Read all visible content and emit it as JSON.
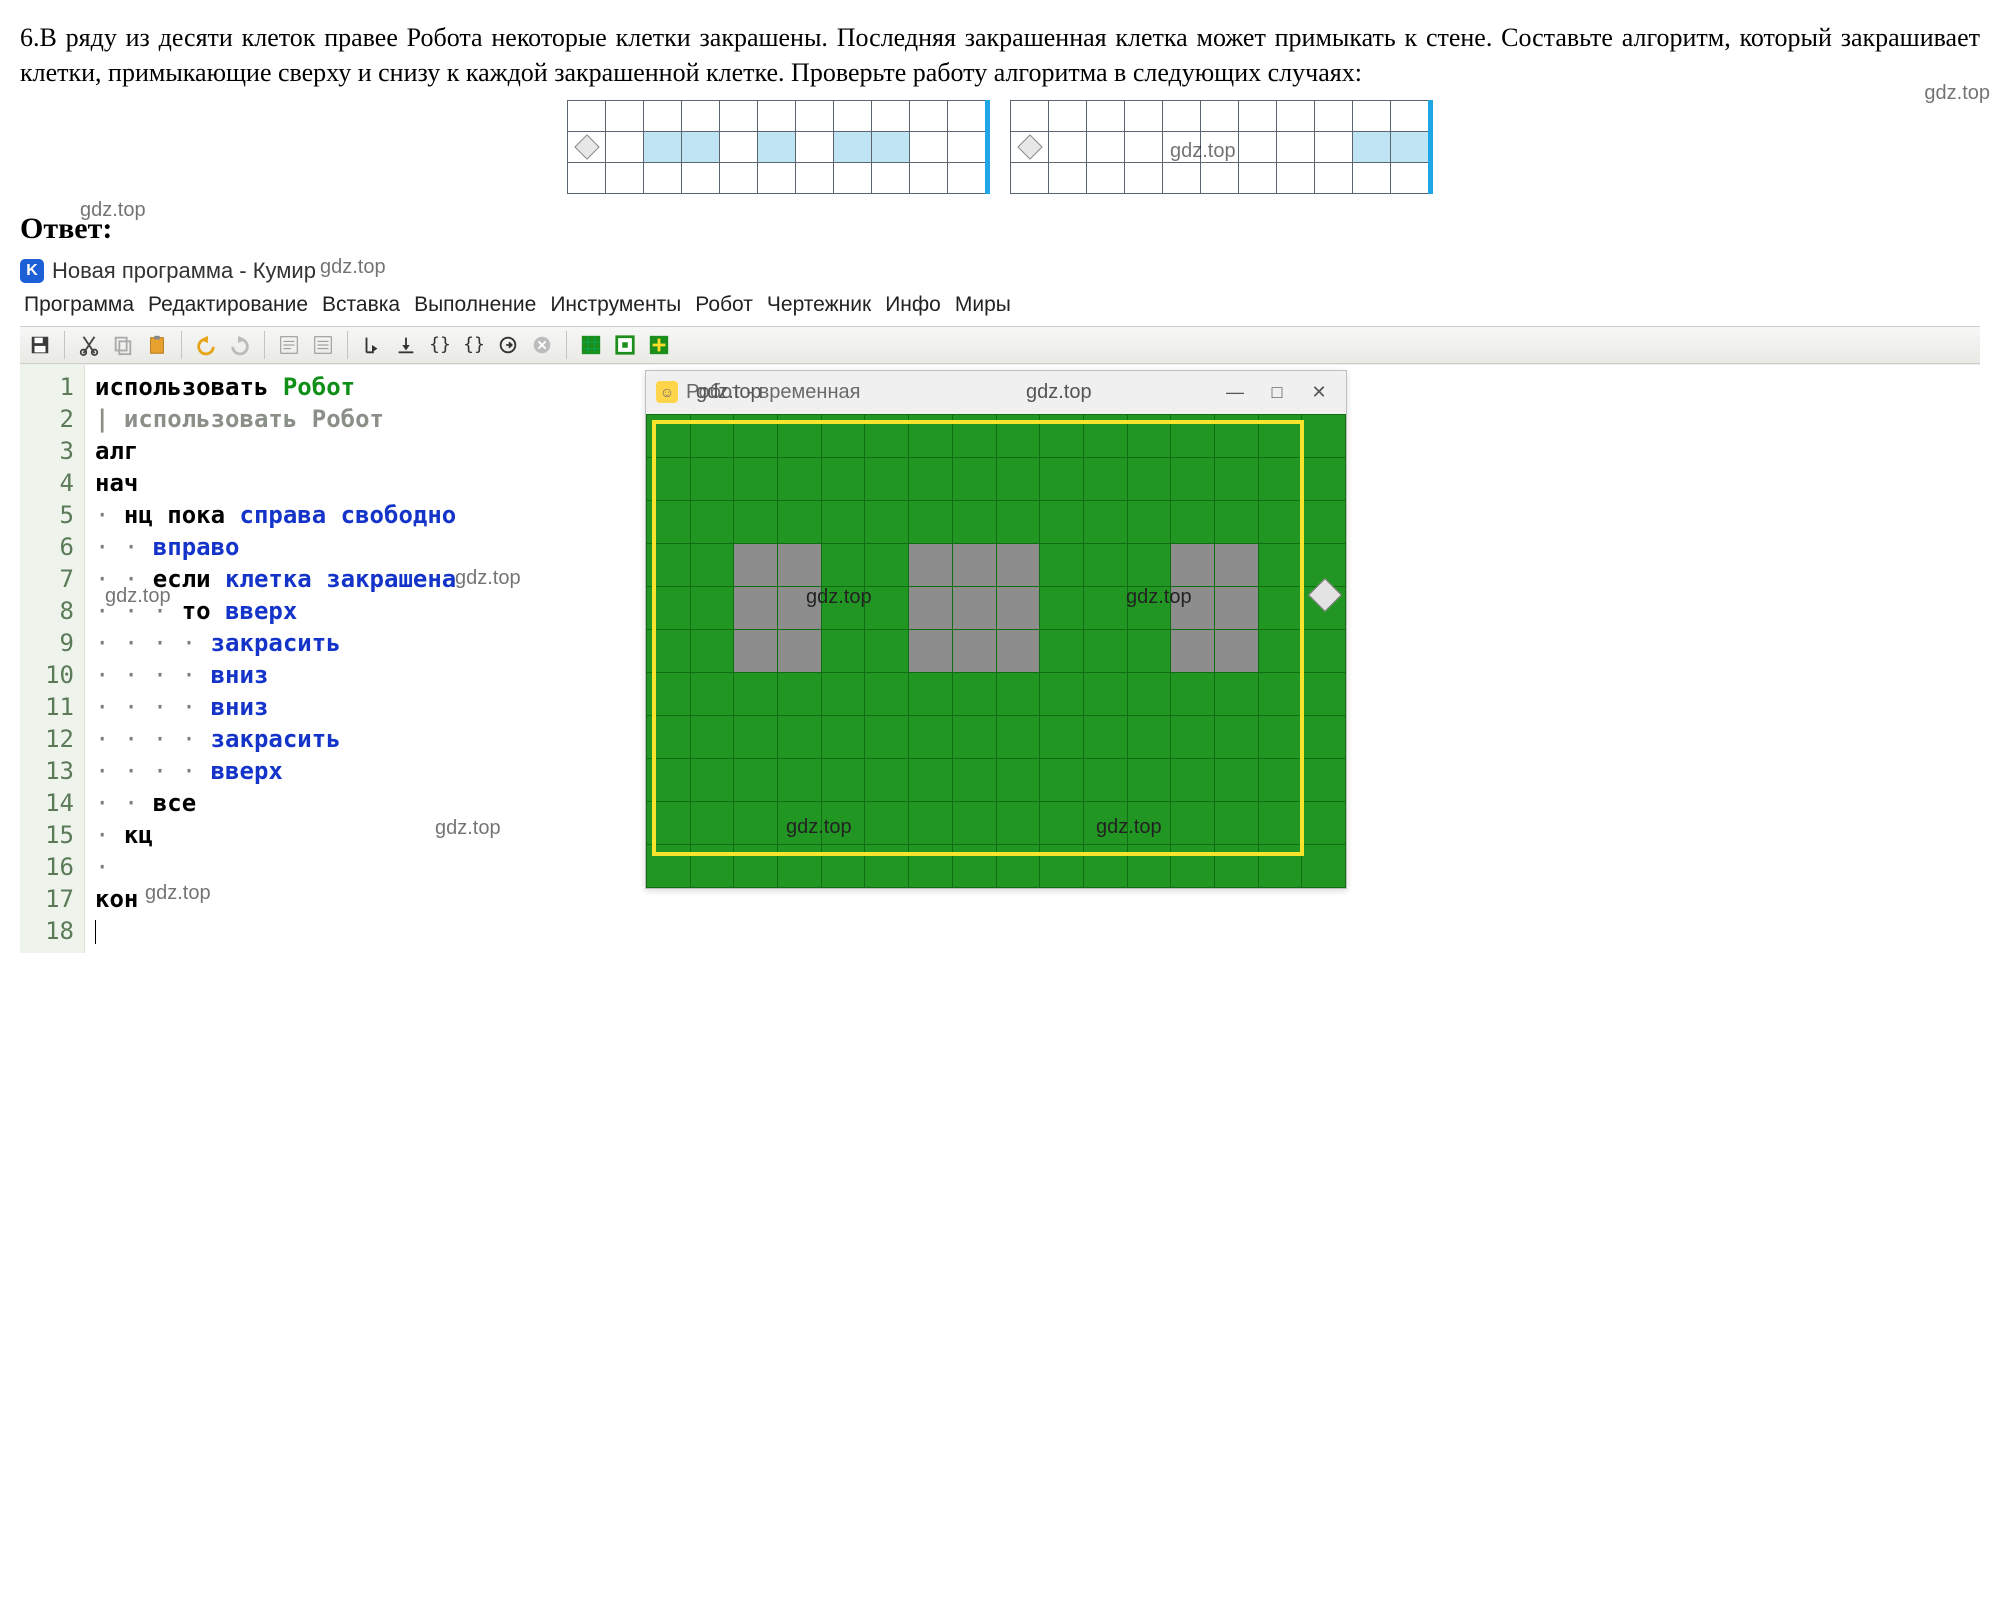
{
  "problem": {
    "text": "6.В ряду из десяти клеток правее Робота некоторые клетки закрашены. Последняя закрашенная клетка может примыкать к стене. Составьте алгоритм, который закрашивает клетки, примыкающие сверху и снизу к каждой закрашенной клетке. Проверьте работу алгоритма в следующих случаях:"
  },
  "watermarks": [
    "gdz.top",
    "gdz.top",
    "gdz.top",
    "gdz.top",
    "gdz.top",
    "gdz.top",
    "gdz.top",
    "gdz.top",
    "gdz.top"
  ],
  "mini_grids": {
    "cols": 11,
    "rows": 3,
    "grid1_shaded_middle_row": [
      false,
      false,
      true,
      true,
      false,
      true,
      false,
      true,
      true,
      false,
      false
    ],
    "grid2_shaded_middle_row": [
      false,
      false,
      false,
      false,
      false,
      false,
      false,
      false,
      false,
      true,
      true
    ]
  },
  "answer_label": "Ответ:",
  "app": {
    "title": "Новая программа - Кумир",
    "menus": [
      "Программа",
      "Редактирование",
      "Вставка",
      "Выполнение",
      "Инструменты",
      "Робот",
      "Чертежник",
      "Инфо",
      "Миры"
    ],
    "toolbar_icons": [
      "save-icon",
      "cut-icon",
      "copy-icon",
      "paste-icon",
      "undo-icon",
      "redo-icon",
      "format-icon",
      "list-icon",
      "step-in-icon",
      "step-over-icon",
      "braces-icon",
      "braces2-icon",
      "run-icon",
      "stop-icon",
      "grid-green-icon",
      "grid-outline-icon",
      "grid-plus-icon"
    ]
  },
  "code": {
    "lines": [
      {
        "n": 1,
        "seg": [
          {
            "t": "использовать ",
            "c": "kw"
          },
          {
            "t": "Робот",
            "c": "kw-green"
          }
        ]
      },
      {
        "n": 2,
        "seg": [
          {
            "t": "| использовать Робот",
            "c": "kw-gray"
          }
        ]
      },
      {
        "n": 3,
        "seg": [
          {
            "t": "алг",
            "c": "kw"
          }
        ]
      },
      {
        "n": 4,
        "seg": [
          {
            "t": "нач",
            "c": "kw"
          }
        ]
      },
      {
        "n": 5,
        "seg": [
          {
            "t": "· ",
            "c": "dot"
          },
          {
            "t": "нц пока ",
            "c": "kw"
          },
          {
            "t": "справа свободно",
            "c": "kw-blue"
          }
        ]
      },
      {
        "n": 6,
        "seg": [
          {
            "t": "· · ",
            "c": "dot"
          },
          {
            "t": "вправо",
            "c": "kw-blue"
          }
        ]
      },
      {
        "n": 7,
        "seg": [
          {
            "t": "· · ",
            "c": "dot"
          },
          {
            "t": "если ",
            "c": "kw"
          },
          {
            "t": "клетка закрашена",
            "c": "kw-blue"
          }
        ]
      },
      {
        "n": 8,
        "seg": [
          {
            "t": "· · · ",
            "c": "dot"
          },
          {
            "t": "то ",
            "c": "kw"
          },
          {
            "t": "вверх",
            "c": "kw-blue"
          }
        ]
      },
      {
        "n": 9,
        "seg": [
          {
            "t": "· · · · ",
            "c": "dot"
          },
          {
            "t": "закрасить",
            "c": "kw-blue"
          }
        ]
      },
      {
        "n": 10,
        "seg": [
          {
            "t": "· · · · ",
            "c": "dot"
          },
          {
            "t": "вниз",
            "c": "kw-blue"
          }
        ]
      },
      {
        "n": 11,
        "seg": [
          {
            "t": "· · · · ",
            "c": "dot"
          },
          {
            "t": "вниз",
            "c": "kw-blue"
          }
        ]
      },
      {
        "n": 12,
        "seg": [
          {
            "t": "· · · · ",
            "c": "dot"
          },
          {
            "t": "закрасить",
            "c": "kw-blue"
          }
        ]
      },
      {
        "n": 13,
        "seg": [
          {
            "t": "· · · · ",
            "c": "dot"
          },
          {
            "t": "вверх",
            "c": "kw-blue"
          }
        ]
      },
      {
        "n": 14,
        "seg": [
          {
            "t": "· · ",
            "c": "dot"
          },
          {
            "t": "все",
            "c": "kw"
          }
        ]
      },
      {
        "n": 15,
        "seg": [
          {
            "t": "· ",
            "c": "dot"
          },
          {
            "t": "кц",
            "c": "kw"
          }
        ]
      },
      {
        "n": 16,
        "seg": [
          {
            "t": "·",
            "c": "dot"
          }
        ]
      },
      {
        "n": 17,
        "seg": [
          {
            "t": "кон",
            "c": "kw"
          }
        ]
      },
      {
        "n": 18,
        "seg": [
          {
            "t": "",
            "c": ""
          }
        ]
      }
    ]
  },
  "robot_window": {
    "title": "Робот - временная",
    "win_buttons": [
      "—",
      "□",
      "✕"
    ],
    "grid": {
      "cols": 16,
      "rows": 11
    },
    "yellow_frame": {
      "left_col": 0,
      "top_row": 0,
      "right_col": 14,
      "bottom_row": 10
    },
    "grey_cells": [
      [
        3,
        2
      ],
      [
        3,
        3
      ],
      [
        3,
        6
      ],
      [
        3,
        7
      ],
      [
        3,
        8
      ],
      [
        3,
        12
      ],
      [
        3,
        13
      ],
      [
        4,
        2
      ],
      [
        4,
        3
      ],
      [
        4,
        6
      ],
      [
        4,
        7
      ],
      [
        4,
        8
      ],
      [
        4,
        12
      ],
      [
        4,
        13
      ],
      [
        5,
        2
      ],
      [
        5,
        3
      ],
      [
        5,
        6
      ],
      [
        5,
        7
      ],
      [
        5,
        8
      ],
      [
        5,
        12
      ],
      [
        5,
        13
      ]
    ],
    "robot_pos": {
      "row": 4,
      "col": 15
    }
  }
}
